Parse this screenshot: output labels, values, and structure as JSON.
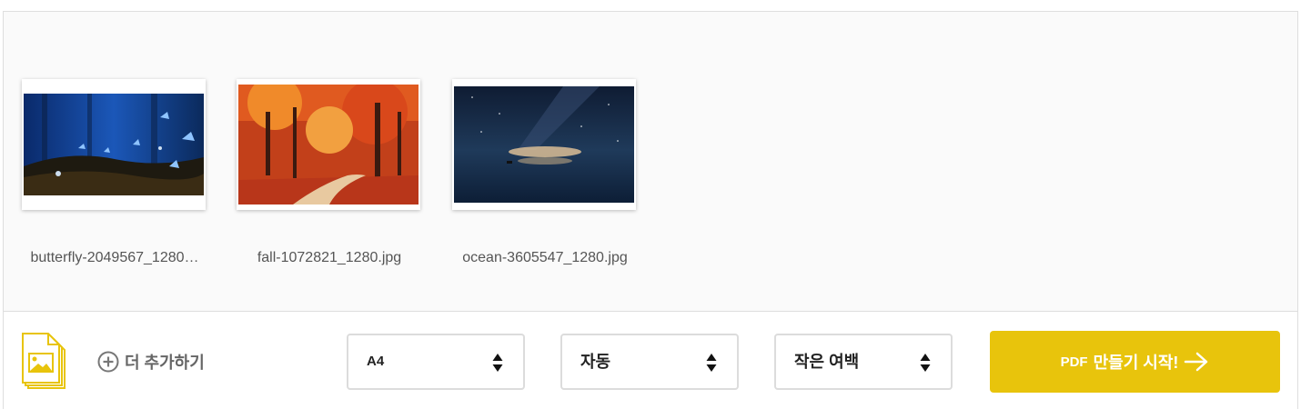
{
  "files": [
    {
      "name": "butterfly-2049567_1280…",
      "image": "blue-butterflies-forest-photo"
    },
    {
      "name": "fall-1072821_1280.jpg",
      "image": "autumn-forest-path-photo"
    },
    {
      "name": "ocean-3605547_1280.jpg",
      "image": "night-ocean-milky-way-photo"
    }
  ],
  "toolbar": {
    "add_more_label": "더 추가하기",
    "page_size": {
      "value": "A4"
    },
    "orientation": {
      "value": "자동"
    },
    "margin": {
      "value": "작은 여백"
    },
    "create_button": {
      "prefix": "PDF",
      "label": "만들기 시작!"
    }
  },
  "colors": {
    "accent": "#e8c40c",
    "border": "#dcdcdc",
    "icon_gray": "#777777"
  },
  "icons": [
    "document-image-icon",
    "plus-circle-icon",
    "select-arrows-icon",
    "arrow-right-icon"
  ]
}
